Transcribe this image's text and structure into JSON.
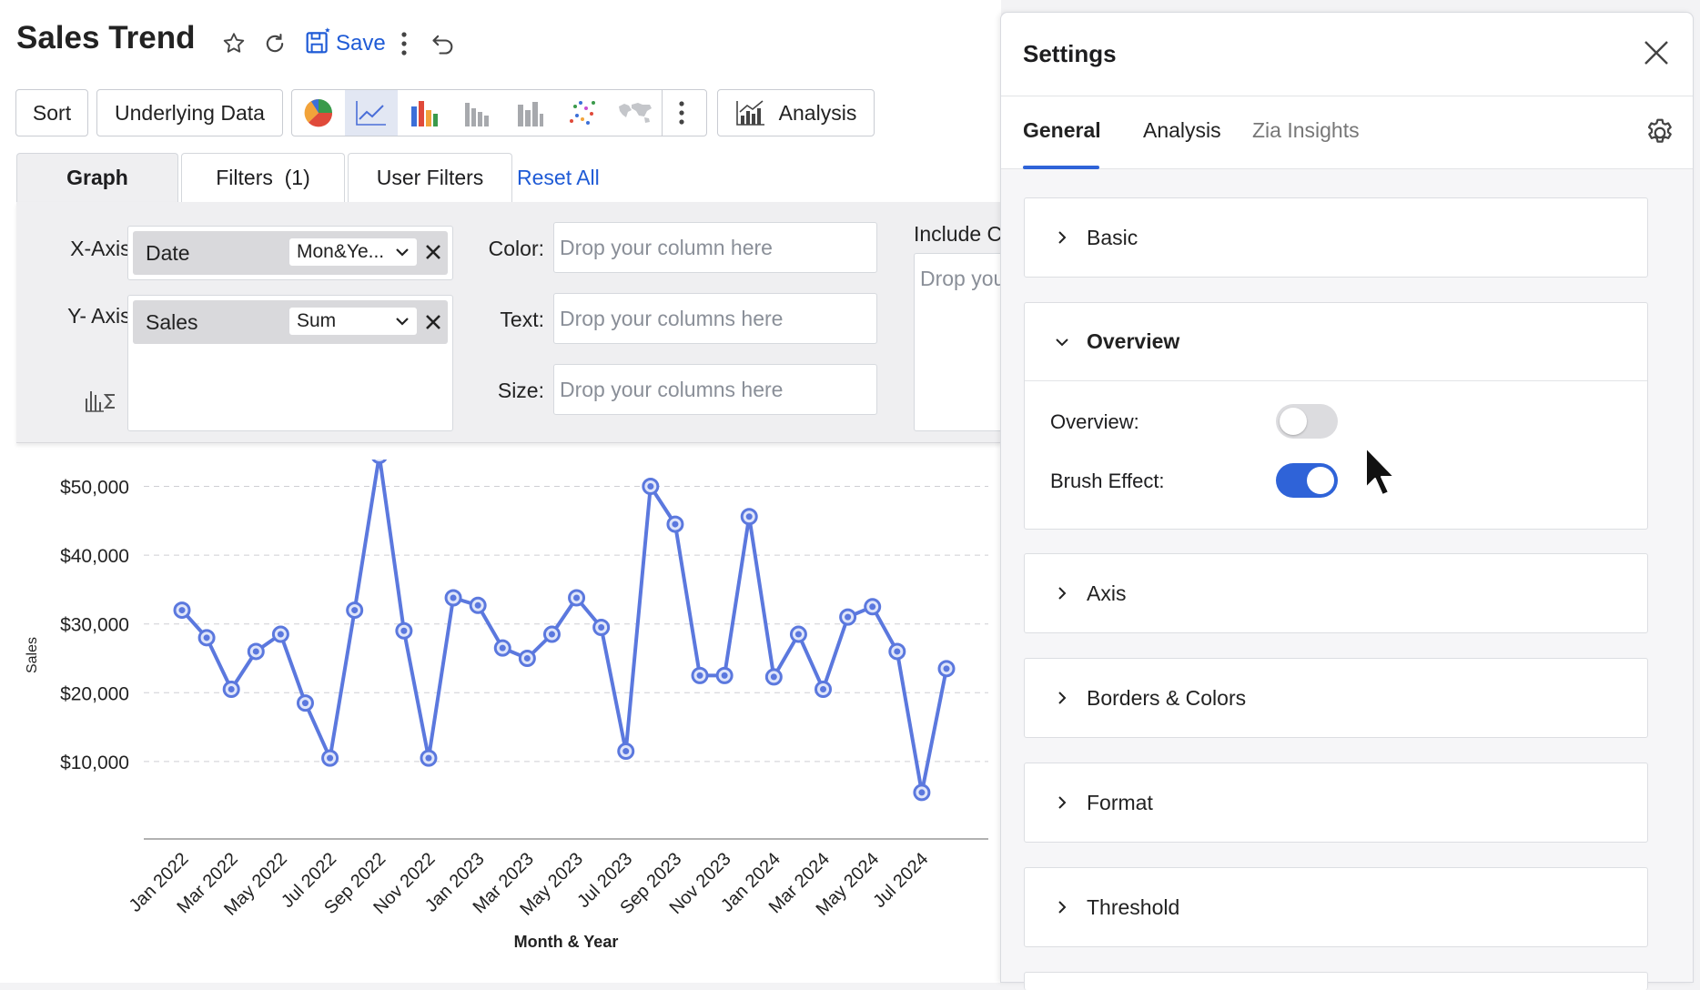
{
  "header": {
    "title": "Sales Trend",
    "save_label": "Save"
  },
  "toolbar": {
    "sort_label": "Sort",
    "underlying_label": "Underlying Data",
    "analysis_label": "Analysis",
    "chart_types": [
      "pie-chart-icon",
      "line-chart-icon",
      "bar-chart-icon",
      "column-chart-icon",
      "stacked-chart-icon",
      "scatter-chart-icon",
      "map-chart-icon"
    ]
  },
  "tabs": {
    "graph": "Graph",
    "filters": "Filters  (1)",
    "user_filters": "User Filters",
    "reset_all": "Reset All"
  },
  "shelf": {
    "xaxis_label": "X-Axis:",
    "xaxis_field": "Date",
    "xaxis_agg": "Mon&Ye...",
    "yaxis_label": "Y- Axis:",
    "yaxis_field": "Sales",
    "yaxis_agg": "Sum",
    "color_label": "Color:",
    "color_placeholder": "Drop your column here",
    "text_label": "Text:",
    "text_placeholder": "Drop your columns here",
    "size_label": "Size:",
    "size_placeholder": "Drop your columns here",
    "include_label": "Include C",
    "include_placeholder": "Drop you"
  },
  "chart_data": {
    "type": "line",
    "xlabel": "Month & Year",
    "ylabel": "Sales",
    "ylim": [
      0,
      55000
    ],
    "yticks": [
      "$10,000",
      "$20,000",
      "$30,000",
      "$40,000",
      "$50,000"
    ],
    "ytick_values": [
      10000,
      20000,
      30000,
      40000,
      50000
    ],
    "grid": "horizontal dashed",
    "color": "#5b78de",
    "xtick_labels": [
      "Jan 2022",
      "Mar 2022",
      "May 2022",
      "Jul 2022",
      "Sep 2022",
      "Nov 2022",
      "Jan 2023",
      "Mar 2023",
      "May 2023",
      "Jul 2023",
      "Sep 2023",
      "Nov 2023",
      "Jan 2024",
      "Mar 2024",
      "May 2024",
      "Jul 2024"
    ],
    "categories": [
      "Jan 2022",
      "Feb 2022",
      "Mar 2022",
      "Apr 2022",
      "May 2022",
      "Jun 2022",
      "Jul 2022",
      "Aug 2022",
      "Sep 2022",
      "Oct 2022",
      "Nov 2022",
      "Dec 2022",
      "Jan 2023",
      "Feb 2023",
      "Mar 2023",
      "Apr 2023",
      "May 2023",
      "Jun 2023",
      "Jul 2023",
      "Aug 2023",
      "Sep 2023",
      "Oct 2023",
      "Nov 2023",
      "Dec 2023",
      "Jan 2024",
      "Feb 2024",
      "Mar 2024",
      "Apr 2024",
      "May 2024",
      "Jun 2024",
      "Jul 2024",
      "Aug 2024"
    ],
    "values": [
      32000,
      28000,
      20500,
      26000,
      28500,
      18500,
      10500,
      32000,
      54500,
      29000,
      10500,
      33800,
      32700,
      26500,
      25000,
      28500,
      33800,
      29500,
      11500,
      50000,
      44500,
      22500,
      22500,
      45600,
      22300,
      28500,
      20500,
      31000,
      32500,
      26000,
      5500,
      23500
    ]
  },
  "settings": {
    "title": "Settings",
    "tabs": [
      "General",
      "Analysis",
      "Zia Insights"
    ],
    "sections": {
      "basic": "Basic",
      "overview": "Overview",
      "axis": "Axis",
      "borders": "Borders & Colors",
      "format": "Format",
      "threshold": "Threshold"
    },
    "overview_label": "Overview:",
    "overview_on": false,
    "brush_label": "Brush Effect:",
    "brush_on": true,
    "toggle_on_color": "#2f63d8",
    "toggle_off_color": "#dcdcdf"
  }
}
